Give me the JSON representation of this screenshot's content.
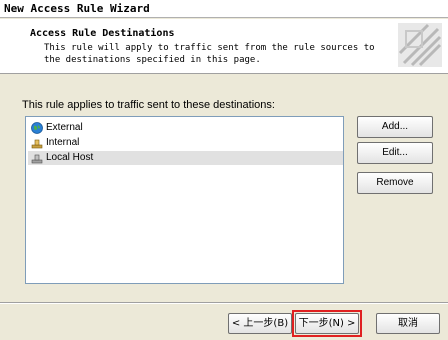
{
  "window": {
    "title": "New Access Rule Wizard"
  },
  "header": {
    "title": "Access Rule Destinations",
    "description": "This rule will apply to traffic sent from the rule sources to the destinations specified in this page."
  },
  "main": {
    "label": "This rule applies to traffic sent to these destinations:",
    "destinations": [
      {
        "label": "External",
        "icon": "globe-icon",
        "selected": false
      },
      {
        "label": "Internal",
        "icon": "network-icon",
        "selected": false
      },
      {
        "label": "Local Host",
        "icon": "host-icon",
        "selected": true
      }
    ],
    "buttons": {
      "add": "Add...",
      "edit": "Edit...",
      "remove": "Remove"
    }
  },
  "footer": {
    "back": "< 上一步(B)",
    "next": "下一步(N) >",
    "cancel": "取消",
    "highlight_color": "#e02020"
  }
}
